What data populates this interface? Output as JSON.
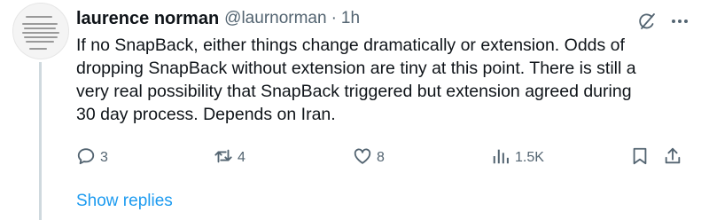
{
  "author": {
    "name": "laurence norman",
    "handle": "@laurnorman",
    "separator": "·",
    "time": "1h"
  },
  "tweet": {
    "text": "If no SnapBack, either things change dramatically or extension. Odds of\ndropping SnapBack without extension are tiny at this point. There is still a\nvery real possibility that SnapBack triggered but extension agreed during\n30 day process. Depends on Iran."
  },
  "actions": {
    "replies": "3",
    "reposts": "4",
    "likes": "8",
    "views": "1.5K"
  },
  "icons": {
    "reply": "reply-icon",
    "repost": "repost-icon",
    "like": "heart-icon",
    "views": "views-icon",
    "bookmark": "bookmark-icon",
    "share": "share-icon",
    "grok": "grok-icon",
    "more": "more-icon"
  },
  "show_replies_label": "Show replies",
  "colors": {
    "link": "#1d9bf0",
    "muted": "#536471",
    "text": "#0f1419"
  }
}
